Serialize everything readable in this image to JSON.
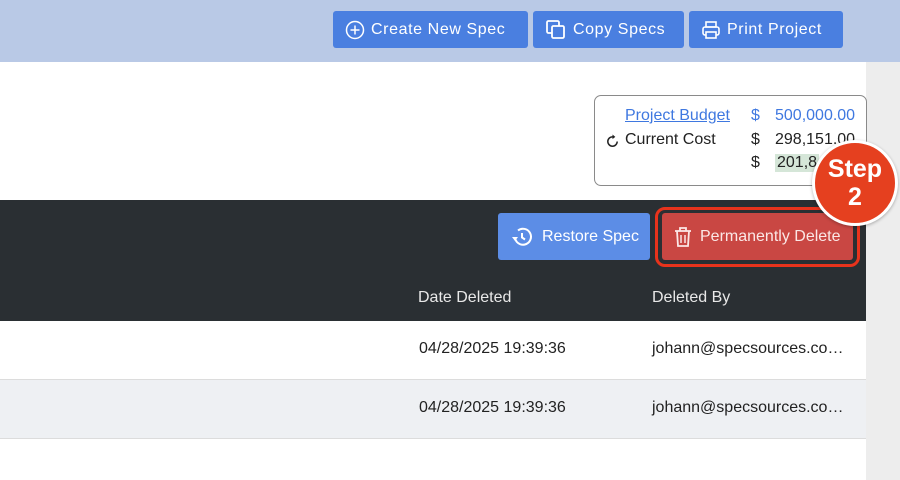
{
  "toolbar": {
    "create_label": "Create New Spec",
    "copy_label": "Copy Specs",
    "print_label": "Print Project"
  },
  "budget": {
    "project_budget_label": "Project Budget",
    "project_budget_currency": "$",
    "project_budget_value": "500,000.00",
    "current_cost_label": "Current Cost",
    "current_cost_currency": "$",
    "current_cost_value": "298,151.00",
    "remaining_currency": "$",
    "remaining_value": "201,8"
  },
  "actions": {
    "restore_label": "Restore Spec",
    "delete_label": "Permanently Delete"
  },
  "step_badge": {
    "title": "Step",
    "number": "2"
  },
  "table": {
    "columns": [
      "Date Deleted",
      "Deleted By"
    ],
    "rows": [
      {
        "date_deleted": "04/28/2025 19:39:36",
        "deleted_by": "johann@specsources.co…"
      },
      {
        "date_deleted": "04/28/2025 19:39:36",
        "deleted_by": "johann@specsources.co…"
      }
    ]
  },
  "colors": {
    "topbar": "#b9c9e6",
    "primary_button": "#4a7fe0",
    "dark_header": "#2a2f33",
    "delete_button": "#c94743",
    "highlight_ring": "#e8331c",
    "step_badge": "#e5401f"
  },
  "icons": {
    "create": "plus-circle-icon",
    "copy": "copy-icon",
    "print": "printer-icon",
    "refresh": "refresh-icon",
    "restore": "history-icon",
    "delete": "trash-icon"
  }
}
